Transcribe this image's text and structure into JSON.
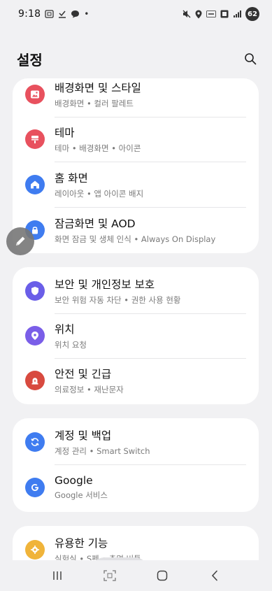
{
  "status_bar": {
    "time": "9:18",
    "dot": "•",
    "battery": "62"
  },
  "header": {
    "title": "설정"
  },
  "cards": [
    {
      "items": [
        {
          "title": "배경화면 및 스타일",
          "subtitle": "배경화면  •  컬러 팔레트",
          "icon": "wallpaper-icon",
          "color": "#e8515e"
        },
        {
          "title": "테마",
          "subtitle": "테마  •  배경화면  •  아이콘",
          "icon": "theme-icon",
          "color": "#e8515e"
        },
        {
          "title": "홈 화면",
          "subtitle": "레이아웃  •  앱 아이콘 배지",
          "icon": "home-icon",
          "color": "#3f7cf0"
        },
        {
          "title": "잠금화면 및 AOD",
          "subtitle": "화면 잠금 및 생체 인식  •  Always On Display",
          "icon": "lock-icon",
          "color": "#3f7cf0"
        }
      ]
    },
    {
      "items": [
        {
          "title": "보안 및 개인정보 보호",
          "subtitle": "보안 위험 자동 차단  •  권한 사용 현황",
          "icon": "shield-icon",
          "color": "#6a5ee8"
        },
        {
          "title": "위치",
          "subtitle": "위치 요청",
          "icon": "location-pin-icon",
          "color": "#7a5ee8"
        },
        {
          "title": "안전 및 긴급",
          "subtitle": "의료정보  •  재난문자",
          "icon": "emergency-icon",
          "color": "#d84a3f"
        }
      ]
    },
    {
      "items": [
        {
          "title": "계정 및 백업",
          "subtitle": "계정 관리  •  Smart Switch",
          "icon": "sync-icon",
          "color": "#3f7cf0"
        },
        {
          "title": "Google",
          "subtitle": "Google 서비스",
          "icon": "google-icon",
          "color": "#3f7cf0"
        }
      ]
    },
    {
      "items": [
        {
          "title": "유용한 기능",
          "subtitle": "실험실  •  S펜  •  측면 버튼",
          "icon": "gear-icon",
          "color": "#f0b43a"
        }
      ]
    }
  ]
}
